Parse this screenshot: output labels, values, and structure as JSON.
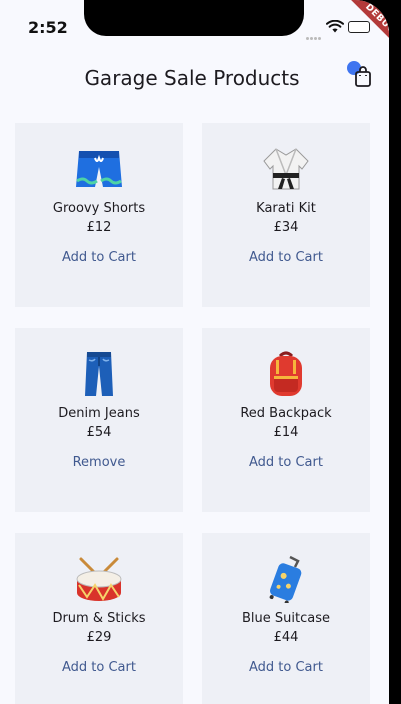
{
  "status_bar": {
    "time": "2:52",
    "debug_label": "DEBUG"
  },
  "app_bar": {
    "title": "Garage Sale Products",
    "cart_icon": "shopping-bag-icon"
  },
  "colors": {
    "background": "#f8f9fe",
    "card": "#eef0f6",
    "accent": "#40598f",
    "badge": "#3f75f0",
    "debug": "#b33a3a"
  },
  "products": [
    {
      "name": "Groovy Shorts",
      "price": "£12",
      "action": "Add to Cart",
      "icon": "shorts-icon"
    },
    {
      "name": "Karati Kit",
      "price": "£34",
      "action": "Add to Cart",
      "icon": "martial-arts-uniform-icon"
    },
    {
      "name": "Denim Jeans",
      "price": "£54",
      "action": "Remove",
      "icon": "jeans-icon"
    },
    {
      "name": "Red Backpack",
      "price": "£14",
      "action": "Add to Cart",
      "icon": "backpack-icon"
    },
    {
      "name": "Drum & Sticks",
      "price": "£29",
      "action": "Add to Cart",
      "icon": "drum-icon"
    },
    {
      "name": "Blue Suitcase",
      "price": "£44",
      "action": "Add to Cart",
      "icon": "suitcase-icon"
    }
  ]
}
